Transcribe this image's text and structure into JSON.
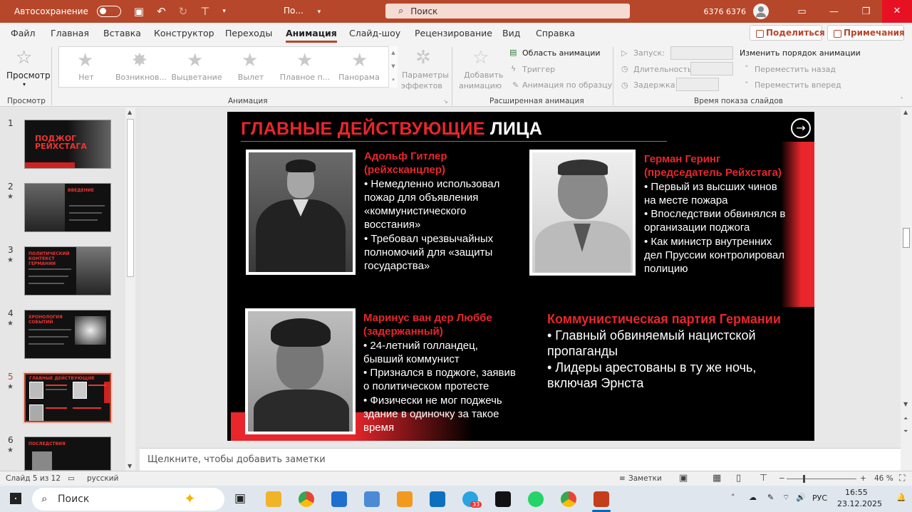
{
  "titlebar": {
    "autosave_label": "Автосохранение",
    "doc_name": "По...",
    "search_placeholder": "Поиск",
    "user_name": "6376 6376"
  },
  "menu": {
    "tabs": [
      "Файл",
      "Главная",
      "Вставка",
      "Конструктор",
      "Переходы",
      "Анимация",
      "Слайд-шоу",
      "Рецензирование",
      "Вид",
      "Справка"
    ],
    "active": "Анимация",
    "share_label": "Поделиться",
    "comments_label": "Примечания"
  },
  "ribbon": {
    "preview_label": "Просмотр",
    "preview_group": "Просмотр",
    "animation_group": "Анимация",
    "effects": [
      "Нет",
      "Возникнов...",
      "Выцветание",
      "Вылет",
      "Плавное п...",
      "Панорама"
    ],
    "effect_params": [
      "Параметры",
      "эффектов"
    ],
    "add_animation": [
      "Добавить",
      "анимацию"
    ],
    "advanced_group": "Расширенная анимация",
    "animation_area": "Область анимации",
    "trigger": "Триггер",
    "animation_painter": "Анимация по образцу",
    "timing_group": "Время показа слайдов",
    "start": "Запуск:",
    "duration": "Длительность:",
    "delay": "Задержка:",
    "reorder": "Изменить порядок анимации",
    "move_back": "Переместить назад",
    "move_forward": "Переместить вперед"
  },
  "thumbnails": [
    {
      "num": "1",
      "star": "",
      "title": "ПОДЖОГ РЕЙХСТАГА"
    },
    {
      "num": "2",
      "star": "★",
      "title": "ВВЕДЕНИЕ"
    },
    {
      "num": "3",
      "star": "★",
      "title": "ПОЛИТИЧЕСКИЙ КОНТЕКСТ ГЕРМАНИИ"
    },
    {
      "num": "4",
      "star": "★",
      "title": "ХРОНОЛОГИЯ СОБЫТИЙ"
    },
    {
      "num": "5",
      "star": "★",
      "title": "ГЛАВНЫЕ ДЕЙСТВУЮЩИЕ ЛИЦА"
    },
    {
      "num": "6",
      "star": "★",
      "title": "ПОСЛЕДСТВИЯ"
    }
  ],
  "slide": {
    "title_red": "ГЛАВНЫЕ ДЕЙСТВУЮЩИЕ",
    "title_white": "ЛИЦА",
    "persons": [
      {
        "name": "Адольф Гитлер",
        "role": "(рейхсканцлер)",
        "lines": [
          "• Немедленно использовал",
          "пожар для объявления",
          "«коммунистического",
          "восстания»",
          "• Требовал чрезвычайных",
          "полномочий для «защиты",
          "государства»"
        ]
      },
      {
        "name": "Герман Геринг",
        "role": "(председатель Рейхстага)",
        "lines": [
          "• Первый из высших чинов",
          "на месте пожара",
          "• Впоследствии обвинялся в",
          "организации поджога",
          "• Как министр внутренних",
          "дел Пруссии контролировал",
          "полицию"
        ]
      },
      {
        "name": "Маринус ван дер Люббе",
        "role": "(задержанный)",
        "lines": [
          "• 24-летний голландец,",
          "бывший коммунист",
          "• Признался в поджоге, заявив",
          "о политическом протесте",
          "• Физически не мог поджечь",
          "здание в одиночку за такое",
          "время"
        ]
      }
    ],
    "party": {
      "name": "Коммунистическая партия Германии",
      "lines": [
        "• Главный обвиняемый нацистской",
        "пропаганды",
        "• Лидеры арестованы в ту же ночь,",
        "включая Эрнста"
      ]
    }
  },
  "notes_placeholder": "Щелкните, чтобы добавить заметки",
  "status": {
    "slide_info": "Слайд 5 из 12",
    "language": "русский",
    "notes_label": "Заметки",
    "zoom": "46 %"
  },
  "taskbar": {
    "search_label": "Поиск",
    "telegram_badge": "33",
    "lang": "РУС",
    "time": "16:55",
    "date": "23.12.2025"
  },
  "colors": {
    "accent": "#b7472a",
    "slide_red": "#e8262b"
  }
}
